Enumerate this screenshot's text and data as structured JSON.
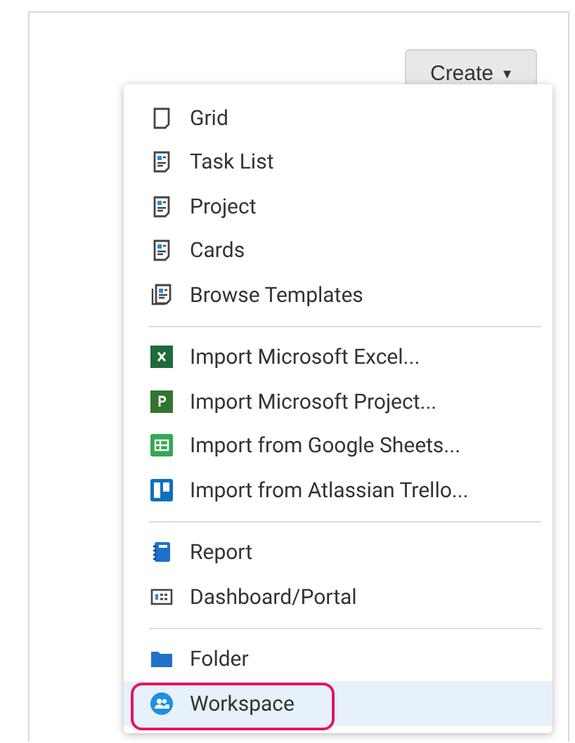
{
  "create_button": {
    "label": "Create",
    "caret": "▾"
  },
  "menu": {
    "groups": [
      {
        "items": [
          {
            "kind": "grid",
            "label": "Grid",
            "selected": false,
            "annotated": false
          },
          {
            "kind": "sheet",
            "label": "Task List",
            "selected": false,
            "annotated": false
          },
          {
            "kind": "sheet",
            "label": "Project",
            "selected": false,
            "annotated": false
          },
          {
            "kind": "sheet",
            "label": "Cards",
            "selected": false,
            "annotated": false
          },
          {
            "kind": "templates",
            "label": "Browse Templates",
            "selected": false,
            "annotated": false
          }
        ]
      },
      {
        "items": [
          {
            "kind": "excel",
            "label": "Import Microsoft Excel...",
            "selected": false,
            "annotated": false
          },
          {
            "kind": "msproject",
            "label": "Import Microsoft Project...",
            "selected": false,
            "annotated": false
          },
          {
            "kind": "gsheets",
            "label": "Import from Google Sheets...",
            "selected": false,
            "annotated": false
          },
          {
            "kind": "trello",
            "label": "Import from Atlassian Trello...",
            "selected": false,
            "annotated": false
          }
        ]
      },
      {
        "items": [
          {
            "kind": "report",
            "label": "Report",
            "selected": false,
            "annotated": false
          },
          {
            "kind": "dashboard",
            "label": "Dashboard/Portal",
            "selected": false,
            "annotated": false
          }
        ]
      },
      {
        "items": [
          {
            "kind": "folder",
            "label": "Folder",
            "selected": false,
            "annotated": false
          },
          {
            "kind": "workspace",
            "label": "Workspace",
            "selected": true,
            "annotated": true
          }
        ]
      }
    ]
  }
}
